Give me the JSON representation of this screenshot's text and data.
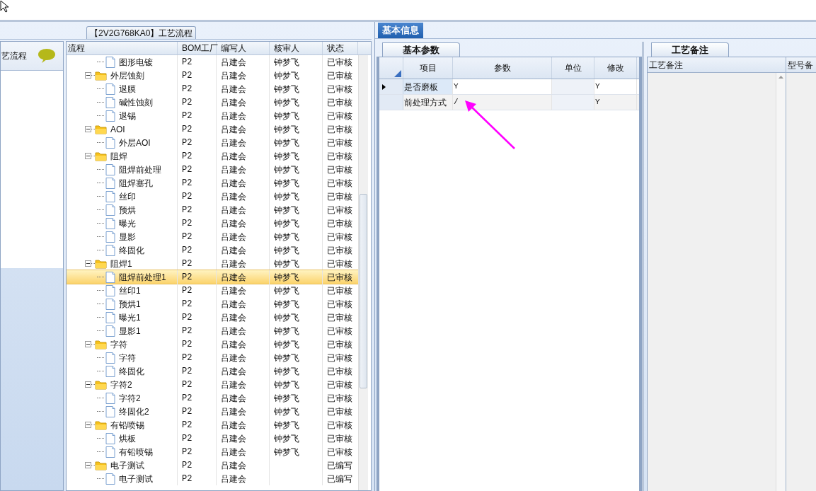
{
  "flow_tab": {
    "label": "【2V2G768KA0】工艺流程"
  },
  "left_panel": {
    "title": "艺流程"
  },
  "tree": {
    "columns": [
      "流程",
      "BOM工厂",
      "编写人",
      "核审人",
      "状态"
    ],
    "nodes": [
      {
        "children": [
          {
            "label": "图形电镀",
            "factory": "P2",
            "author": "吕建会",
            "reviewer": "钟梦飞",
            "status": "已审核",
            "selected": false
          }
        ]
      },
      {
        "label": "外层蚀刻",
        "factory": "P2",
        "author": "吕建会",
        "reviewer": "钟梦飞",
        "status": "已审核",
        "selected": false,
        "expanded": true,
        "children": [
          {
            "label": "退膜",
            "factory": "P2",
            "author": "吕建会",
            "reviewer": "钟梦飞",
            "status": "已审核",
            "selected": false
          },
          {
            "label": "碱性蚀刻",
            "factory": "P2",
            "author": "吕建会",
            "reviewer": "钟梦飞",
            "status": "已审核",
            "selected": false
          },
          {
            "label": "退锡",
            "factory": "P2",
            "author": "吕建会",
            "reviewer": "钟梦飞",
            "status": "已审核",
            "selected": false
          }
        ]
      },
      {
        "label": "AOI",
        "factory": "P2",
        "author": "吕建会",
        "reviewer": "钟梦飞",
        "status": "已审核",
        "selected": false,
        "expanded": true,
        "children": [
          {
            "label": "外层AOI",
            "factory": "P2",
            "author": "吕建会",
            "reviewer": "钟梦飞",
            "status": "已审核",
            "selected": false
          }
        ]
      },
      {
        "label": "阻焊",
        "factory": "P2",
        "author": "吕建会",
        "reviewer": "钟梦飞",
        "status": "已审核",
        "selected": false,
        "expanded": true,
        "children": [
          {
            "label": "阻焊前处理",
            "factory": "P2",
            "author": "吕建会",
            "reviewer": "钟梦飞",
            "status": "已审核",
            "selected": false
          },
          {
            "label": "阻焊塞孔",
            "factory": "P2",
            "author": "吕建会",
            "reviewer": "钟梦飞",
            "status": "已审核",
            "selected": false
          },
          {
            "label": "丝印",
            "factory": "P2",
            "author": "吕建会",
            "reviewer": "钟梦飞",
            "status": "已审核",
            "selected": false
          },
          {
            "label": "预烘",
            "factory": "P2",
            "author": "吕建会",
            "reviewer": "钟梦飞",
            "status": "已审核",
            "selected": false
          },
          {
            "label": "曝光",
            "factory": "P2",
            "author": "吕建会",
            "reviewer": "钟梦飞",
            "status": "已审核",
            "selected": false
          },
          {
            "label": "显影",
            "factory": "P2",
            "author": "吕建会",
            "reviewer": "钟梦飞",
            "status": "已审核",
            "selected": false
          },
          {
            "label": "终固化",
            "factory": "P2",
            "author": "吕建会",
            "reviewer": "钟梦飞",
            "status": "已审核",
            "selected": false
          }
        ]
      },
      {
        "label": "阻焊1",
        "factory": "P2",
        "author": "吕建会",
        "reviewer": "钟梦飞",
        "status": "已审核",
        "selected": false,
        "expanded": true,
        "children": [
          {
            "label": "阻焊前处理1",
            "factory": "P2",
            "author": "吕建会",
            "reviewer": "钟梦飞",
            "status": "已审核",
            "selected": true
          },
          {
            "label": "丝印1",
            "factory": "P2",
            "author": "吕建会",
            "reviewer": "钟梦飞",
            "status": "已审核",
            "selected": false
          },
          {
            "label": "预烘1",
            "factory": "P2",
            "author": "吕建会",
            "reviewer": "钟梦飞",
            "status": "已审核",
            "selected": false
          },
          {
            "label": "曝光1",
            "factory": "P2",
            "author": "吕建会",
            "reviewer": "钟梦飞",
            "status": "已审核",
            "selected": false
          },
          {
            "label": "显影1",
            "factory": "P2",
            "author": "吕建会",
            "reviewer": "钟梦飞",
            "status": "已审核",
            "selected": false
          }
        ]
      },
      {
        "label": "字符",
        "factory": "P2",
        "author": "吕建会",
        "reviewer": "钟梦飞",
        "status": "已审核",
        "selected": false,
        "expanded": true,
        "children": [
          {
            "label": "字符",
            "factory": "P2",
            "author": "吕建会",
            "reviewer": "钟梦飞",
            "status": "已审核",
            "selected": false
          },
          {
            "label": "终固化",
            "factory": "P2",
            "author": "吕建会",
            "reviewer": "钟梦飞",
            "status": "已审核",
            "selected": false
          }
        ]
      },
      {
        "label": "字符2",
        "factory": "P2",
        "author": "吕建会",
        "reviewer": "钟梦飞",
        "status": "已审核",
        "selected": false,
        "expanded": true,
        "children": [
          {
            "label": "字符2",
            "factory": "P2",
            "author": "吕建会",
            "reviewer": "钟梦飞",
            "status": "已审核",
            "selected": false
          },
          {
            "label": "终固化2",
            "factory": "P2",
            "author": "吕建会",
            "reviewer": "钟梦飞",
            "status": "已审核",
            "selected": false
          }
        ]
      },
      {
        "label": "有铅喷锡",
        "factory": "P2",
        "author": "吕建会",
        "reviewer": "钟梦飞",
        "status": "已审核",
        "selected": false,
        "expanded": true,
        "children": [
          {
            "label": "烘板",
            "factory": "P2",
            "author": "吕建会",
            "reviewer": "钟梦飞",
            "status": "已审核",
            "selected": false
          },
          {
            "label": "有铅喷锡",
            "factory": "P2",
            "author": "吕建会",
            "reviewer": "钟梦飞",
            "status": "已审核",
            "selected": false
          }
        ]
      },
      {
        "label": "电子测试",
        "factory": "P2",
        "author": "吕建会",
        "status": "已编写",
        "selected": false,
        "expanded": true,
        "children": [
          {
            "label": "电子测试",
            "factory": "P2",
            "author": "吕建会",
            "status": "已编写",
            "selected": false
          }
        ]
      }
    ]
  },
  "info_tab": {
    "label": "基本信息",
    "selected": true
  },
  "params": {
    "tab": "基本参数",
    "columns": [
      "项目",
      "参数",
      "单位",
      "修改"
    ],
    "rows": [
      {
        "item": "是否磨板",
        "value": "Y",
        "unit_value": "",
        "modified": "Y",
        "selected": true
      },
      {
        "item": "前处理方式",
        "value": "/",
        "modified": "Y",
        "selected": false
      }
    ]
  },
  "notes": {
    "tab": "工艺备注",
    "columns": [
      "工艺备注",
      "型号备"
    ]
  }
}
